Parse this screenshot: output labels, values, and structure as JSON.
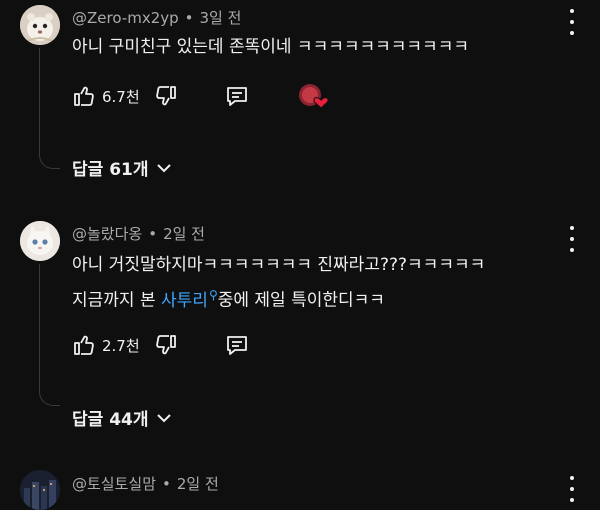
{
  "comments": [
    {
      "author": "@Zero-mx2yp",
      "time": "3일 전",
      "text": "아니 구미친구 있는데 존똑이네 ㅋㅋㅋㅋㅋㅋㅋㅋㅋㅋㅋ",
      "likes": "6.7천",
      "replies_label": "답글 61개",
      "creator_heart": true
    },
    {
      "author": "@놀랐다옹",
      "time": "2일 전",
      "line1": "아니 거짓말하지마ㅋㅋㅋㅋㅋㅋㅋ 진짜라고???ㅋㅋㅋㅋㅋ",
      "line2_before": "지금까지 본 ",
      "line2_link": "사투리",
      "line2_after": "중에 제일 특이한디ㅋㅋ",
      "likes": "2.7천",
      "replies_label": "답글 44개"
    },
    {
      "author": "@토실토실맘",
      "time": "2일 전"
    }
  ],
  "icons": {
    "like": "thumb-up-icon",
    "dislike": "thumb-down-icon",
    "reply": "reply-icon",
    "more": "more-vert-icon",
    "expand": "chevron-down-icon",
    "search": "search-icon"
  },
  "colors": {
    "background": "#0f0f0f",
    "text": "#f1f1f1",
    "meta": "#aaaaaa",
    "link": "#3ea6ff",
    "heart": "#e8213a"
  }
}
